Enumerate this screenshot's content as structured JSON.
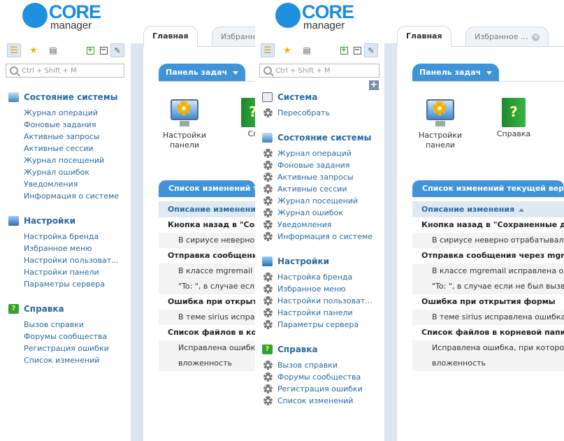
{
  "brand": {
    "core": "CORE",
    "manager": "manager"
  },
  "search": {
    "placeholder": "Ctrl + Shift + M"
  },
  "tabs": {
    "home": "Главная",
    "favorites_left": "Избранное",
    "favorites_right": "Избранное ..."
  },
  "left_nav": [
    {
      "title": "Состояние системы",
      "icon": "monitor-icon",
      "items": [
        "Журнал операций",
        "Фоновые задания",
        "Активные запросы",
        "Активные сессии",
        "Журнал посещений",
        "Журнал ошибок",
        "Уведомления",
        "Информация о системе"
      ]
    },
    {
      "title": "Настройки",
      "icon": "settings-icon",
      "items": [
        "Настройка бренда",
        "Избранное меню",
        "Настройки пользоват...",
        "Настройки панели",
        "Параметры сервера"
      ]
    },
    {
      "title": "Справка",
      "icon": "help-icon",
      "items": [
        "Вызов справки",
        "Форумы сообщества",
        "Регистрация ошибки",
        "Список изменений"
      ]
    }
  ],
  "right_nav": [
    {
      "title": "Система",
      "icon": "calculator-icon",
      "items": [
        "Пересобрать"
      ]
    },
    {
      "title": "Состояние системы",
      "icon": "monitor-icon",
      "items": [
        "Журнал операций",
        "Фоновые задания",
        "Активные запросы",
        "Активные сессии",
        "Журнал посещений",
        "Журнал ошибок",
        "Уведомления",
        "Информация о системе"
      ]
    },
    {
      "title": "Настройки",
      "icon": "settings-icon",
      "items": [
        "Настройка бренда",
        "Избранное меню",
        "Настройки пользоват...",
        "Настройки панели",
        "Параметры сервера"
      ]
    },
    {
      "title": "Справка",
      "icon": "help-icon",
      "items": [
        "Вызов справки",
        "Форумы сообщества",
        "Регистрация ошибки",
        "Список изменений"
      ]
    }
  ],
  "taskbar": {
    "label": "Панель задач"
  },
  "tiles": {
    "settings_panel": "Настройки панели",
    "help": "Справка",
    "help_cut": "Сп"
  },
  "changes": {
    "title_left": "Список изменений те",
    "title_right": "Список изменений текущей версии",
    "col_left": "Описание изменения",
    "col_right": "Описание изменения",
    "rows_left": [
      {
        "t": "h",
        "v": "Кнопка назад в \"Сохра"
      },
      {
        "t": "d",
        "v": "В сириусе неверно о"
      },
      {
        "t": "h",
        "v": "Отправка сообщения"
      },
      {
        "t": "d",
        "v": "В классе mgremail испр"
      },
      {
        "t": "d2",
        "v": "\"To: \", в случае если"
      },
      {
        "t": "h",
        "v": "Ошибка при открытия"
      },
      {
        "t": "d",
        "v": "В теме sirius исправ"
      },
      {
        "t": "h",
        "v": "Список файлов в корн"
      },
      {
        "t": "d",
        "v": "Исправлена ошибка,"
      },
      {
        "t": "d2",
        "v": "вложенность"
      }
    ],
    "rows_right": [
      {
        "t": "h",
        "v": "Кнопка назад в \"Сохраненные данны"
      },
      {
        "t": "d",
        "v": "В сириусе неверно отрабатывала кн"
      },
      {
        "t": "h",
        "v": "Отправка сообщения через mgrema"
      },
      {
        "t": "d",
        "v": "В классе mgremail исправлена ошибк"
      },
      {
        "t": "d2",
        "v": "\"To: \", в случае если не был вызван"
      },
      {
        "t": "h",
        "v": "Ошибка при открытия формы"
      },
      {
        "t": "d",
        "v": "В теме sirius исправлена ошибка, из-"
      },
      {
        "t": "h",
        "v": "Список файлов в корневой папке пр"
      },
      {
        "t": "d",
        "v": "Исправлена ошибка, при которой в с"
      },
      {
        "t": "d2",
        "v": "вложенность"
      }
    ]
  }
}
